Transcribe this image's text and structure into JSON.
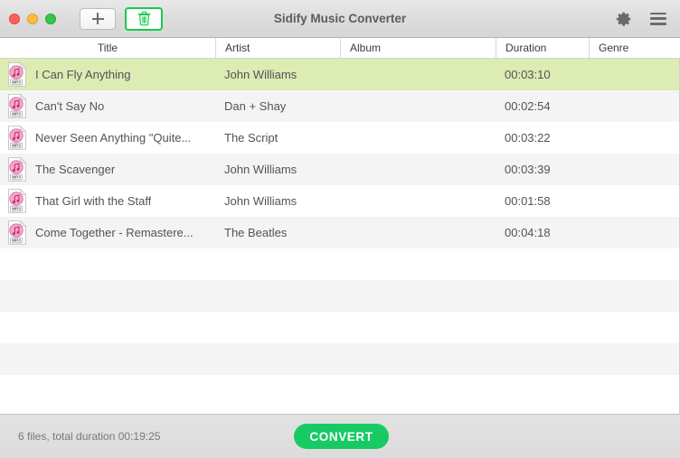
{
  "window": {
    "title": "Sidify Music Converter",
    "traffic_lights": [
      {
        "name": "close",
        "color": "#fc615d"
      },
      {
        "name": "minimize",
        "color": "#fdbc40"
      },
      {
        "name": "zoom",
        "color": "#34c749"
      }
    ]
  },
  "toolbar": {
    "add_label": "+",
    "add_icon": "plus-icon",
    "delete_icon": "trash-icon",
    "delete_accent_color": "#18cb4d",
    "settings_icon": "gear-icon",
    "menu_icon": "hamburger-menu-icon"
  },
  "table": {
    "columns": [
      {
        "key": "title",
        "label": "Title"
      },
      {
        "key": "artist",
        "label": "Artist"
      },
      {
        "key": "album",
        "label": "Album"
      },
      {
        "key": "duration",
        "label": "Duration"
      },
      {
        "key": "genre",
        "label": "Genre"
      }
    ],
    "selection_color": "#dcecb3",
    "rows": [
      {
        "icon": "mp3-file-icon",
        "title": "I Can Fly Anything",
        "artist": "John Williams",
        "album": "",
        "duration": "00:03:10",
        "genre": "",
        "selected": true
      },
      {
        "icon": "mp3-file-icon",
        "title": "Can't Say No",
        "artist": "Dan + Shay",
        "album": "",
        "duration": "00:02:54",
        "genre": "",
        "selected": false
      },
      {
        "icon": "mp3-file-icon",
        "title": "Never Seen Anything \"Quite...",
        "artist": "The Script",
        "album": "",
        "duration": "00:03:22",
        "genre": "",
        "selected": false
      },
      {
        "icon": "mp3-file-icon",
        "title": "The Scavenger",
        "artist": "John Williams",
        "album": "",
        "duration": "00:03:39",
        "genre": "",
        "selected": false
      },
      {
        "icon": "mp3-file-icon",
        "title": "That Girl with the Staff",
        "artist": "John Williams",
        "album": "",
        "duration": "00:01:58",
        "genre": "",
        "selected": false
      },
      {
        "icon": "mp3-file-icon",
        "title": "Come Together - Remastere...",
        "artist": "The Beatles",
        "album": "",
        "duration": "00:04:18",
        "genre": "",
        "selected": false
      }
    ],
    "empty_row_count": 5
  },
  "statusbar": {
    "summary": "6 files, total duration 00:19:25",
    "convert_label": "CONVERT",
    "convert_color": "#17ca63"
  }
}
